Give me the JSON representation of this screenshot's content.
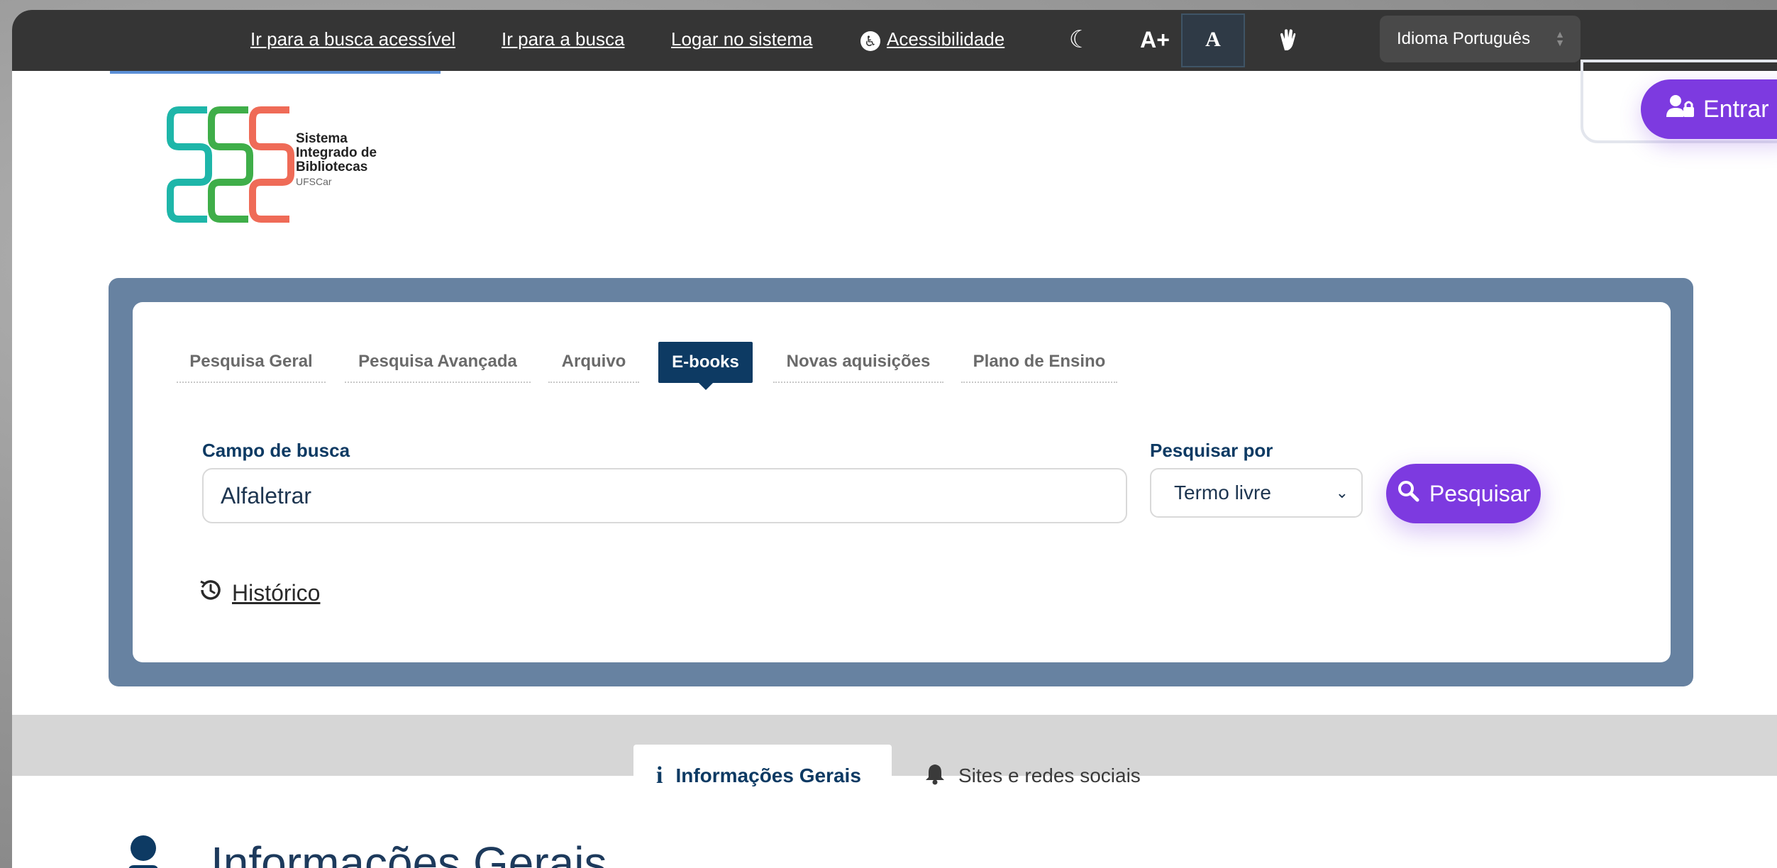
{
  "topbar": {
    "links": [
      "Ir para a busca acessível",
      "Ir para a busca",
      "Logar no sistema",
      "Acessibilidade"
    ],
    "contrast_label": "A+",
    "font_label": "A",
    "language": "Idioma Português"
  },
  "logo": {
    "line1": "Sistema",
    "line2": "Integrado de",
    "line3": "Bibliotecas",
    "line4": "UFSCar"
  },
  "header": {
    "login_button": "Entrar"
  },
  "search": {
    "tabs": [
      "Pesquisa Geral",
      "Pesquisa Avançada",
      "Arquivo",
      "E-books",
      "Novas aquisições",
      "Plano de Ensino"
    ],
    "active_tab": "E-books",
    "field_label": "Campo de busca",
    "field_value": "Alfaletrar",
    "searchby_label": "Pesquisar por",
    "searchby_value": "Termo livre",
    "button_label": "Pesquisar",
    "history_label": "Histórico"
  },
  "info_tabs": [
    "Informações Gerais",
    "Sites e redes sociais"
  ],
  "section_title": "Informações Gerais",
  "colors": {
    "topbar": "#353535",
    "accent_purple": "#7d3ae0",
    "navy": "#0d3a63",
    "panel_blue": "#6782a1"
  }
}
